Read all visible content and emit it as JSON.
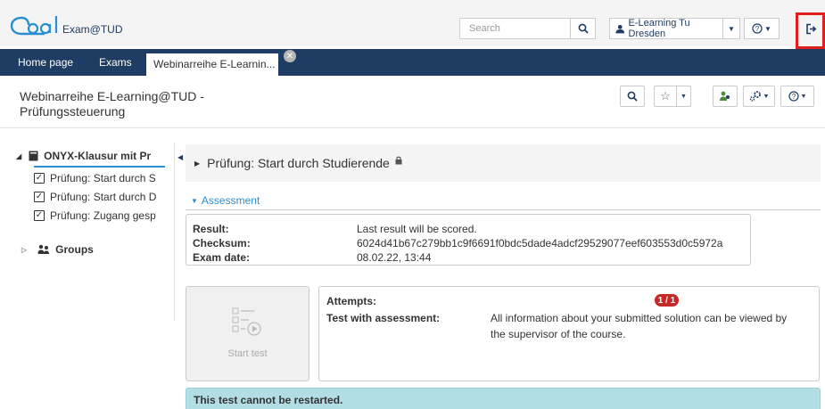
{
  "header": {
    "logo_text": "Exam@TUD",
    "search_placeholder": "Search",
    "user_label": "E-Learning Tu Dresden",
    "icons": [
      "search-icon",
      "user-icon",
      "help-icon",
      "logout-icon"
    ]
  },
  "nav": {
    "items": [
      {
        "label": "Home page"
      },
      {
        "label": "Exams"
      }
    ],
    "active_tab": "Webinarreihe E-Learnin..."
  },
  "course": {
    "title_line1": "Webinarreihe E-Learning@TUD -",
    "title_line2": "Prüfungssteuerung"
  },
  "sidebar": {
    "root": "ONYX-Klausur mit Pr",
    "items": [
      {
        "label": "Prüfung: Start durch S"
      },
      {
        "label": "Prüfung: Start durch D"
      },
      {
        "label": "Prüfung: Zugang gesp"
      }
    ],
    "groups": "Groups"
  },
  "node": {
    "title": "Prüfung: Start durch Studierende",
    "section_toggle": "Assessment"
  },
  "result": {
    "result_label": "Result:",
    "result_value": "Last result will be scored.",
    "checksum_label": "Checksum:",
    "checksum_value": "6024d41b67c279bb1c9f6691f0bdc5dade4adcf29529077eef603553d0c5972a",
    "date_label": "Exam date:",
    "date_value": "08.02.22, 13:44"
  },
  "start": {
    "label": "Start test"
  },
  "attempts": {
    "attempts_label": "Attempts:",
    "attempts_badge": "1 / 1",
    "assessment_label": "Test with assessment:",
    "assessment_line1": "All information about your submitted solution can be viewed by",
    "assessment_line2": "the supervisor of the course."
  },
  "notice": {
    "text": "This test cannot be restarted."
  },
  "colors": {
    "brand": "#1e3c64",
    "accent": "#2a8fd0",
    "highlight": "#e21e1e",
    "badge": "#c62828",
    "info": "#b2dde4"
  }
}
